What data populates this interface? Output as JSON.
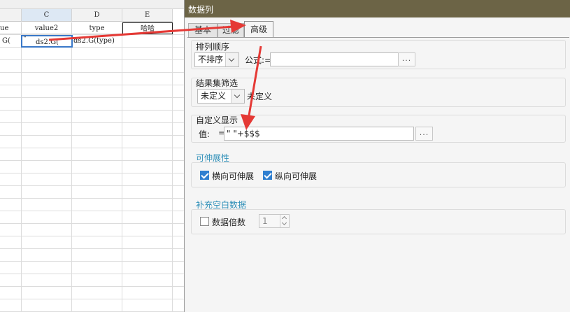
{
  "spreadsheet": {
    "columns": [
      {
        "letter": "",
        "selected": false
      },
      {
        "letter": "C",
        "selected": true
      },
      {
        "letter": "D",
        "selected": false
      },
      {
        "letter": "E",
        "selected": false
      }
    ],
    "header_row": [
      "ue",
      "value2",
      "type",
      "哈哈"
    ],
    "data_row": [
      "G(",
      "ds2.G(",
      "ds2.G(type)",
      ""
    ],
    "selected_cell_prefix": "\""
  },
  "dialog": {
    "title": "数据列",
    "tabs": [
      "基本",
      "过滤",
      "高级"
    ],
    "active_tab": "高级",
    "sort": {
      "title": "排列顺序",
      "order_value": "不排序",
      "formula_label": "公式:=",
      "formula_value": "",
      "dots": "..."
    },
    "result_filter": {
      "title": "结果集筛选",
      "value": "未定义",
      "text": "未定义"
    },
    "custom_display": {
      "title": "自定义显示",
      "value_label": "值:",
      "equals": "=",
      "value": "\" \"+$$$",
      "dots": "..."
    },
    "extensible": {
      "title": "可伸展性",
      "horizontal": {
        "label": "横向可伸展",
        "checked": true
      },
      "vertical": {
        "label": "纵向可伸展",
        "checked": true
      }
    },
    "fill_blank": {
      "title": "补充空白数据",
      "multiple_label": "数据倍数",
      "multiple_checked": false,
      "multiple_value": "1"
    }
  },
  "colors": {
    "title_bar": "#6c6446",
    "section_title": "#2e8fb8",
    "checkbox_checked": "#2f7fd0",
    "cell_selection": "#3a78c8",
    "annotation_arrow": "#e53935"
  }
}
